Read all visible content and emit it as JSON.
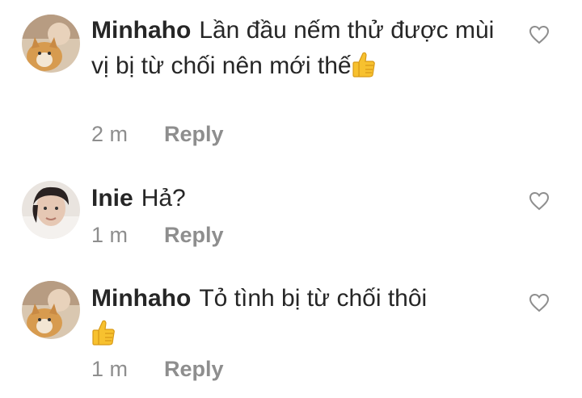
{
  "comments": [
    {
      "username": "Minhaho",
      "text": "Lần đầu nếm thử được mùi vị bị từ chối nên mới thế",
      "emoji": "thumbs-up-icon",
      "time": "2 m",
      "reply_label": "Reply"
    },
    {
      "username": "Inie",
      "text": "Hả?",
      "time": "1 m",
      "reply_label": "Reply"
    },
    {
      "username": "Minhaho",
      "text": "Tỏ tình bị từ chối thôi",
      "emoji": "thumbs-up-icon",
      "time": "1 m",
      "reply_label": "Reply"
    }
  ],
  "colors": {
    "text": "#262626",
    "meta": "#8e8e8e",
    "heart_outline": "#8e8e8e",
    "thumb": "#f7c12f"
  }
}
